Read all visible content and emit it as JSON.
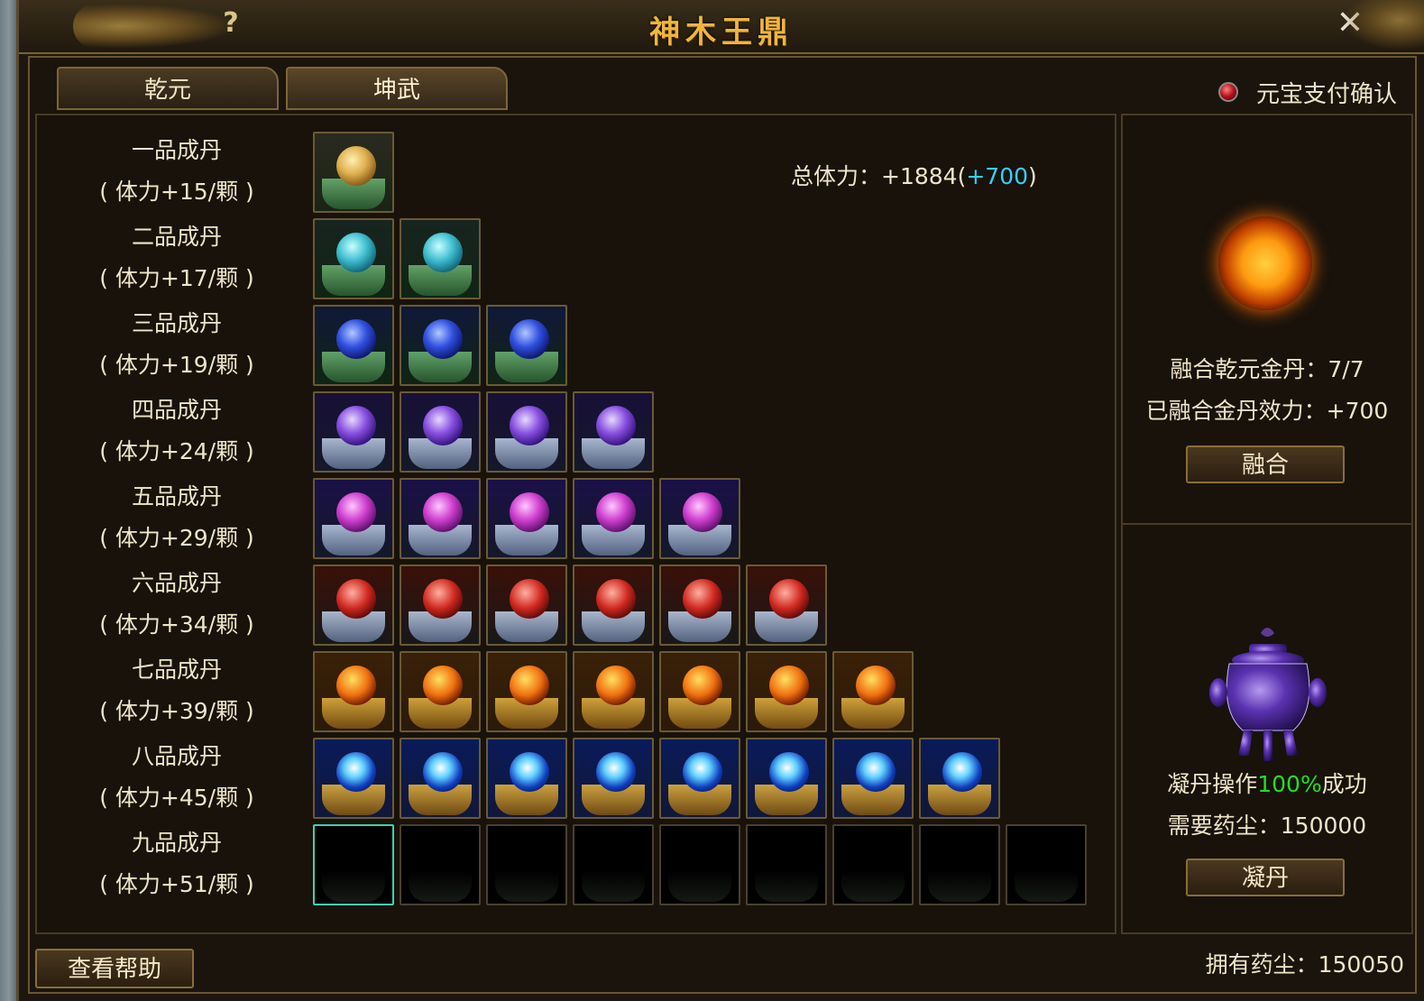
{
  "window": {
    "title": "神木王鼎",
    "help_icon": "?",
    "close_icon": "✕"
  },
  "tabs": [
    {
      "label": "乾元",
      "active": false
    },
    {
      "label": "坤武",
      "active": true
    }
  ],
  "confirm": {
    "label": "元宝支付确认"
  },
  "grades": [
    {
      "name": "一品成丹",
      "bonus": "( 体力+15/颗 )",
      "filled": 1,
      "color": "gold"
    },
    {
      "name": "二品成丹",
      "bonus": "( 体力+17/颗 )",
      "filled": 2,
      "color": "cyan"
    },
    {
      "name": "三品成丹",
      "bonus": "( 体力+19/颗 )",
      "filled": 3,
      "color": "blue"
    },
    {
      "name": "四品成丹",
      "bonus": "( 体力+24/颗 )",
      "filled": 4,
      "color": "violet"
    },
    {
      "name": "五品成丹",
      "bonus": "( 体力+29/颗 )",
      "filled": 5,
      "color": "magenta"
    },
    {
      "name": "六品成丹",
      "bonus": "( 体力+34/颗 )",
      "filled": 6,
      "color": "red"
    },
    {
      "name": "七品成丹",
      "bonus": "( 体力+39/颗 )",
      "filled": 7,
      "color": "fire"
    },
    {
      "name": "八品成丹",
      "bonus": "( 体力+45/颗 )",
      "filled": 8,
      "color": "electric"
    },
    {
      "name": "九品成丹",
      "bonus": "( 体力+51/颗 )",
      "filled": 0,
      "color": "empty",
      "slots": 9
    }
  ],
  "stats": {
    "total_prefix": "总体力：+1884",
    "total_open": "(",
    "total_bonus": "+700",
    "total_close": ")"
  },
  "fusion": {
    "count_label": "融合乾元金丹：7/7",
    "effect_label": "已融合金丹效力：+700",
    "button": "融合"
  },
  "condense": {
    "success_prefix": "凝丹操作",
    "success_rate": "100%",
    "success_suffix": "成功",
    "cost_label": "需要药尘：150000",
    "button": "凝丹"
  },
  "footer": {
    "help_button": "查看帮助",
    "owned_dust": "拥有药尘：150050"
  },
  "colors": {
    "title": "#f0b53a",
    "bonus_cyan": "#34d0ff",
    "success_green": "#20e020",
    "text": "#efe5c8"
  }
}
